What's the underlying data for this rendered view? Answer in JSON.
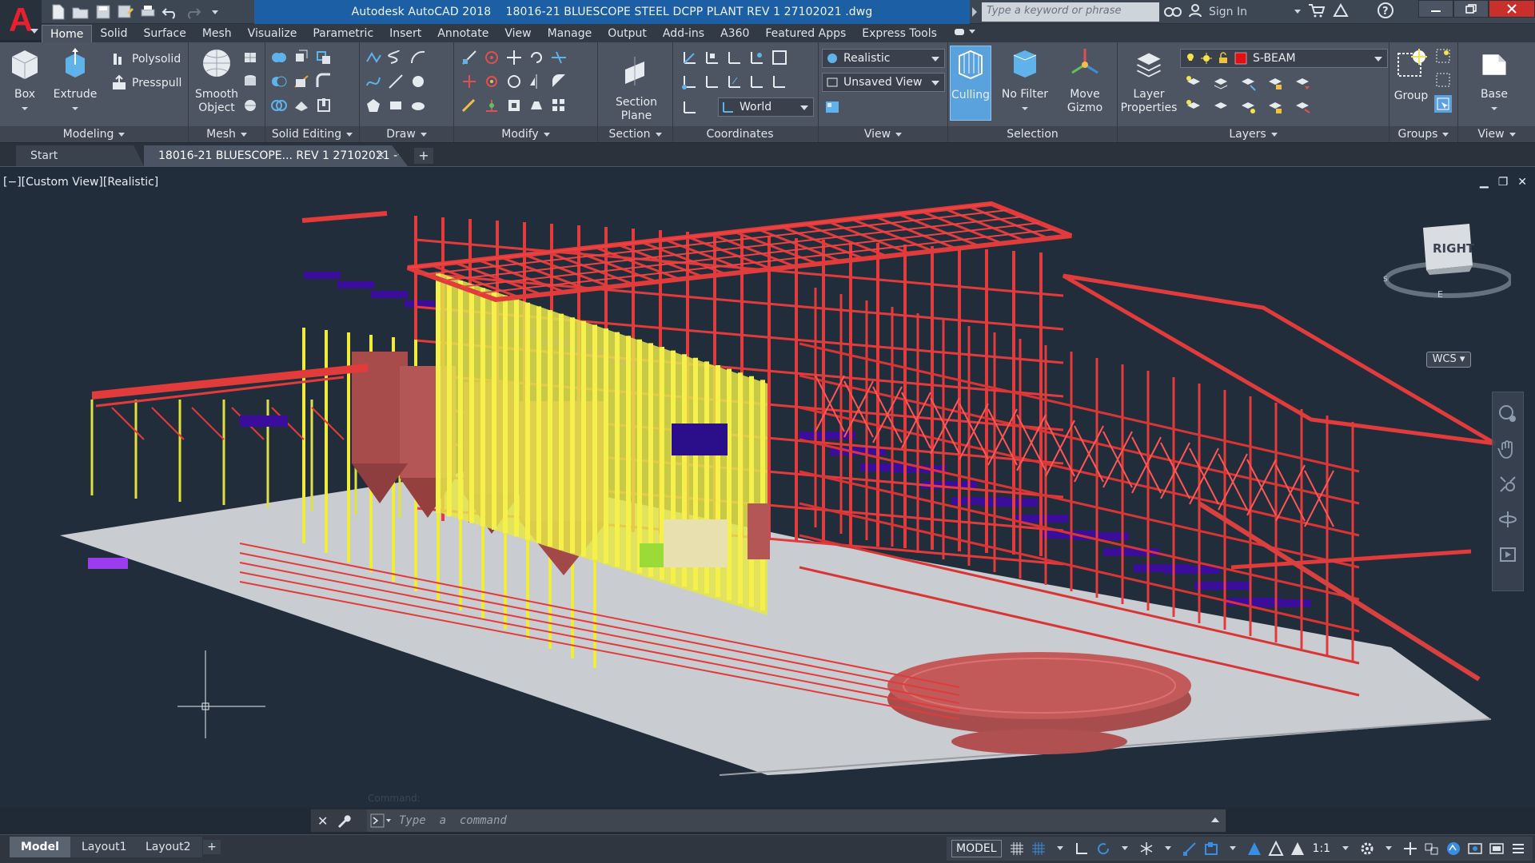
{
  "title_bar": {
    "app_name": "Autodesk AutoCAD 2018",
    "document": "18016-21 BLUESCOPE STEEL DCPP PLANT REV 1 27102021 .dwg",
    "search_placeholder": "Type a keyword or phrase",
    "sign_in": "Sign In"
  },
  "menu_tabs": [
    "Home",
    "Solid",
    "Surface",
    "Mesh",
    "Visualize",
    "Parametric",
    "Insert",
    "Annotate",
    "View",
    "Manage",
    "Output",
    "Add-ins",
    "A360",
    "Featured Apps",
    "Express Tools"
  ],
  "ribbon": {
    "modeling": {
      "label": "Modeling",
      "box": "Box",
      "extrude": "Extrude",
      "polysolid": "Polysolid",
      "presspull": "Presspull"
    },
    "mesh": {
      "label": "Mesh",
      "smooth_line1": "Smooth",
      "smooth_line2": "Object"
    },
    "solid_editing": {
      "label": "Solid Editing"
    },
    "draw": {
      "label": "Draw"
    },
    "modify": {
      "label": "Modify"
    },
    "section": {
      "label": "Section",
      "btn_line1": "Section",
      "btn_line2": "Plane"
    },
    "coordinates": {
      "label": "Coordinates",
      "ucs_combo": "World"
    },
    "view": {
      "label": "View",
      "visual_style": "Realistic",
      "named_view": "Unsaved View"
    },
    "selection": {
      "label": "Selection",
      "culling": "Culling",
      "no_filter": "No Filter",
      "move_line1": "Move",
      "move_line2": "Gizmo"
    },
    "layers": {
      "label": "Layers",
      "layer_props_line1": "Layer",
      "layer_props_line2": "Properties",
      "current_layer": "S-BEAM",
      "layer_color": "#e01010"
    },
    "groups": {
      "label": "Groups",
      "group": "Group"
    },
    "view2": {
      "label": "View",
      "base": "Base"
    }
  },
  "file_tabs": {
    "start": "Start",
    "document": "18016-21 BLUESCOPE... REV 1 27102021 -*"
  },
  "viewport": {
    "label": "[−][Custom View][Realistic]",
    "viewcube_face": "RIGHT",
    "wcs": "WCS"
  },
  "command_line": {
    "placeholder": "Type  a  command",
    "ghost": "Command:"
  },
  "layout_tabs": [
    "Model",
    "Layout1",
    "Layout2"
  ],
  "status_bar": {
    "model": "MODEL",
    "scale": "1:1"
  }
}
